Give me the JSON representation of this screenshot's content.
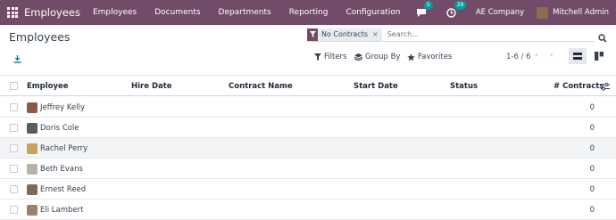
{
  "navbar": {
    "app_title": "Employees",
    "menu": [
      "Employees",
      "Documents",
      "Departments",
      "Reporting",
      "Configuration"
    ],
    "messages_count": "5",
    "activities_count": "29",
    "company": "AE Company",
    "user": "Mitchell Admin",
    "bg_color": "#714b67"
  },
  "control_panel": {
    "title": "Employees",
    "facet": "No Contracts",
    "search_placeholder": "Search...",
    "filters_label": "Filters",
    "group_by_label": "Group By",
    "favorites_label": "Favorites",
    "pager": "1-6 / 6"
  },
  "table": {
    "columns": [
      "Employee",
      "Hire Date",
      "Contract Name",
      "Start Date",
      "Status",
      "# Contracts"
    ],
    "rows": [
      {
        "name": "Jeffrey Kelly",
        "contracts": "0",
        "avatar_color": "#8a5a44"
      },
      {
        "name": "Doris Cole",
        "contracts": "0",
        "avatar_color": "#5b5b5b"
      },
      {
        "name": "Rachel Perry",
        "contracts": "0",
        "avatar_color": "#c9a063"
      },
      {
        "name": "Beth Evans",
        "contracts": "0",
        "avatar_color": "#b9b2a8"
      },
      {
        "name": "Ernest Reed",
        "contracts": "0",
        "avatar_color": "#7a6a58"
      },
      {
        "name": "Eli Lambert",
        "contracts": "0",
        "avatar_color": "#9a8070"
      }
    ]
  }
}
